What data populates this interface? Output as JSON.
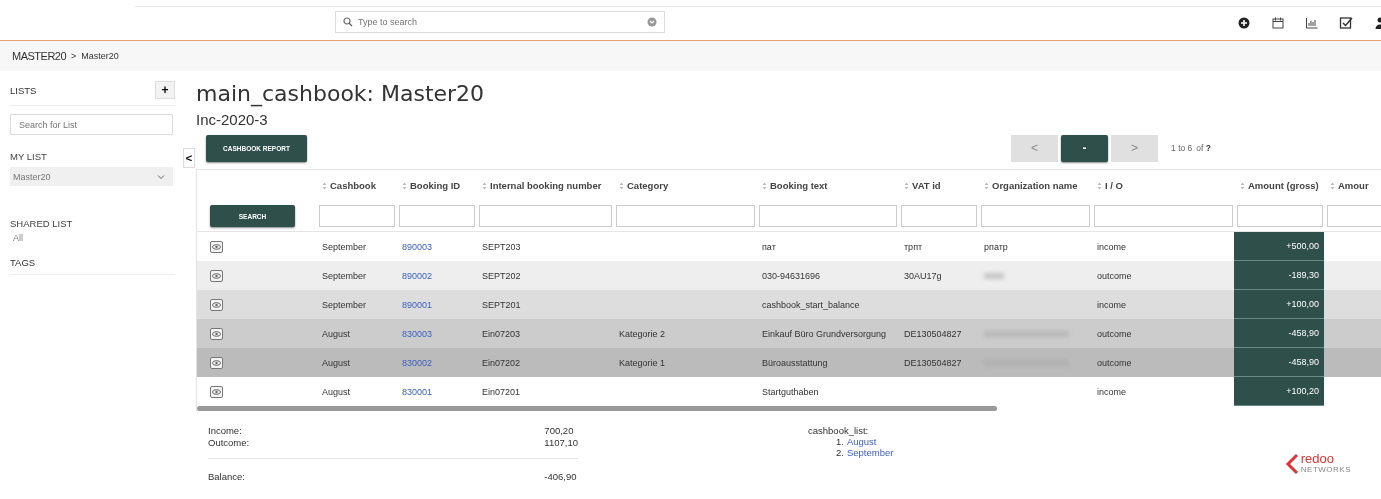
{
  "topbar": {
    "search": {
      "placeholder": "Type to search"
    }
  },
  "breadcrumb": {
    "root": "MASTER20",
    "separator": ">",
    "current": "Master20"
  },
  "sidebar": {
    "lists_label": "LISTS",
    "add": "+",
    "search": {
      "placeholder": "Search for List"
    },
    "my_list_label": "MY LIST",
    "my_list_value": "Master20",
    "shared_label": "SHARED LIST",
    "shared_items": [
      "All"
    ],
    "tags_label": "TAGS",
    "collapse": "<"
  },
  "page": {
    "title": "main_cashbook: Master20",
    "subtitle": "Inc-2020-3",
    "report_button": "CASHBOOK REPORT"
  },
  "pager": {
    "prev": "<",
    "current": "-",
    "next": ">",
    "range": "1 to 6",
    "of": "of",
    "total": "?"
  },
  "table": {
    "search_button": "SEARCH",
    "columns": [
      "Cashbook",
      "Booking ID",
      "Internal booking number",
      "Category",
      "Booking text",
      "VAT id",
      "Organization name",
      "I / O",
      "Amount (gross)",
      "Amour"
    ],
    "rows": [
      {
        "color": "#ffffff",
        "cashbook": "September",
        "booking_id": "890003",
        "internal": "SEPT203",
        "category": "",
        "text": "пат",
        "vat": "трпт",
        "org": "рпатр",
        "org_redacted": false,
        "io": "income",
        "amount": "+500,00"
      },
      {
        "color": "#eeeeee",
        "cashbook": "September",
        "booking_id": "890002",
        "internal": "SEPT202",
        "category": "",
        "text": "030-94631696",
        "vat": "30AU17g",
        "org": "",
        "org_redacted": true,
        "io": "outcome",
        "amount": "-189,30"
      },
      {
        "color": "#dddddd",
        "cashbook": "September",
        "booking_id": "890001",
        "internal": "SEPT201",
        "category": "",
        "text": "cashbook_start_balance",
        "vat": "",
        "org": "",
        "org_redacted": false,
        "io": "income",
        "amount": "+100,00"
      },
      {
        "color": "#cccccc",
        "cashbook": "August",
        "booking_id": "830003",
        "internal": "Ein07203",
        "category": "Kategorie 2",
        "text": "Einkauf Büro Grundversorgung",
        "vat": "DE130504827",
        "org": "",
        "org_redacted": true,
        "io": "outcome",
        "amount": "-458,90"
      },
      {
        "color": "#bbbbbb",
        "cashbook": "August",
        "booking_id": "830002",
        "internal": "Ein07202",
        "category": "Kategorie 1",
        "text": "Büroausstattung",
        "vat": "DE130504827",
        "org": "",
        "org_redacted": true,
        "io": "outcome",
        "amount": "-458,90"
      },
      {
        "color": "#ffffff",
        "cashbook": "August",
        "booking_id": "830001",
        "internal": "Ein07201",
        "category": "",
        "text": "Startguthaben",
        "vat": "",
        "org": "",
        "org_redacted": false,
        "io": "income",
        "amount": "+100,20"
      }
    ]
  },
  "summary": {
    "income_label": "Income:",
    "income": "700,20",
    "outcome_label": "Outcome:",
    "outcome": "1107,10",
    "balance_label": "Balance:",
    "balance": "-406,90"
  },
  "cashbook_list": {
    "label": "cashbook_list:",
    "items": [
      {
        "num": "1.",
        "name": "August"
      },
      {
        "num": "2.",
        "name": "September"
      }
    ]
  },
  "logo": {
    "name": "redoo",
    "tagline": "NETWORKS"
  }
}
